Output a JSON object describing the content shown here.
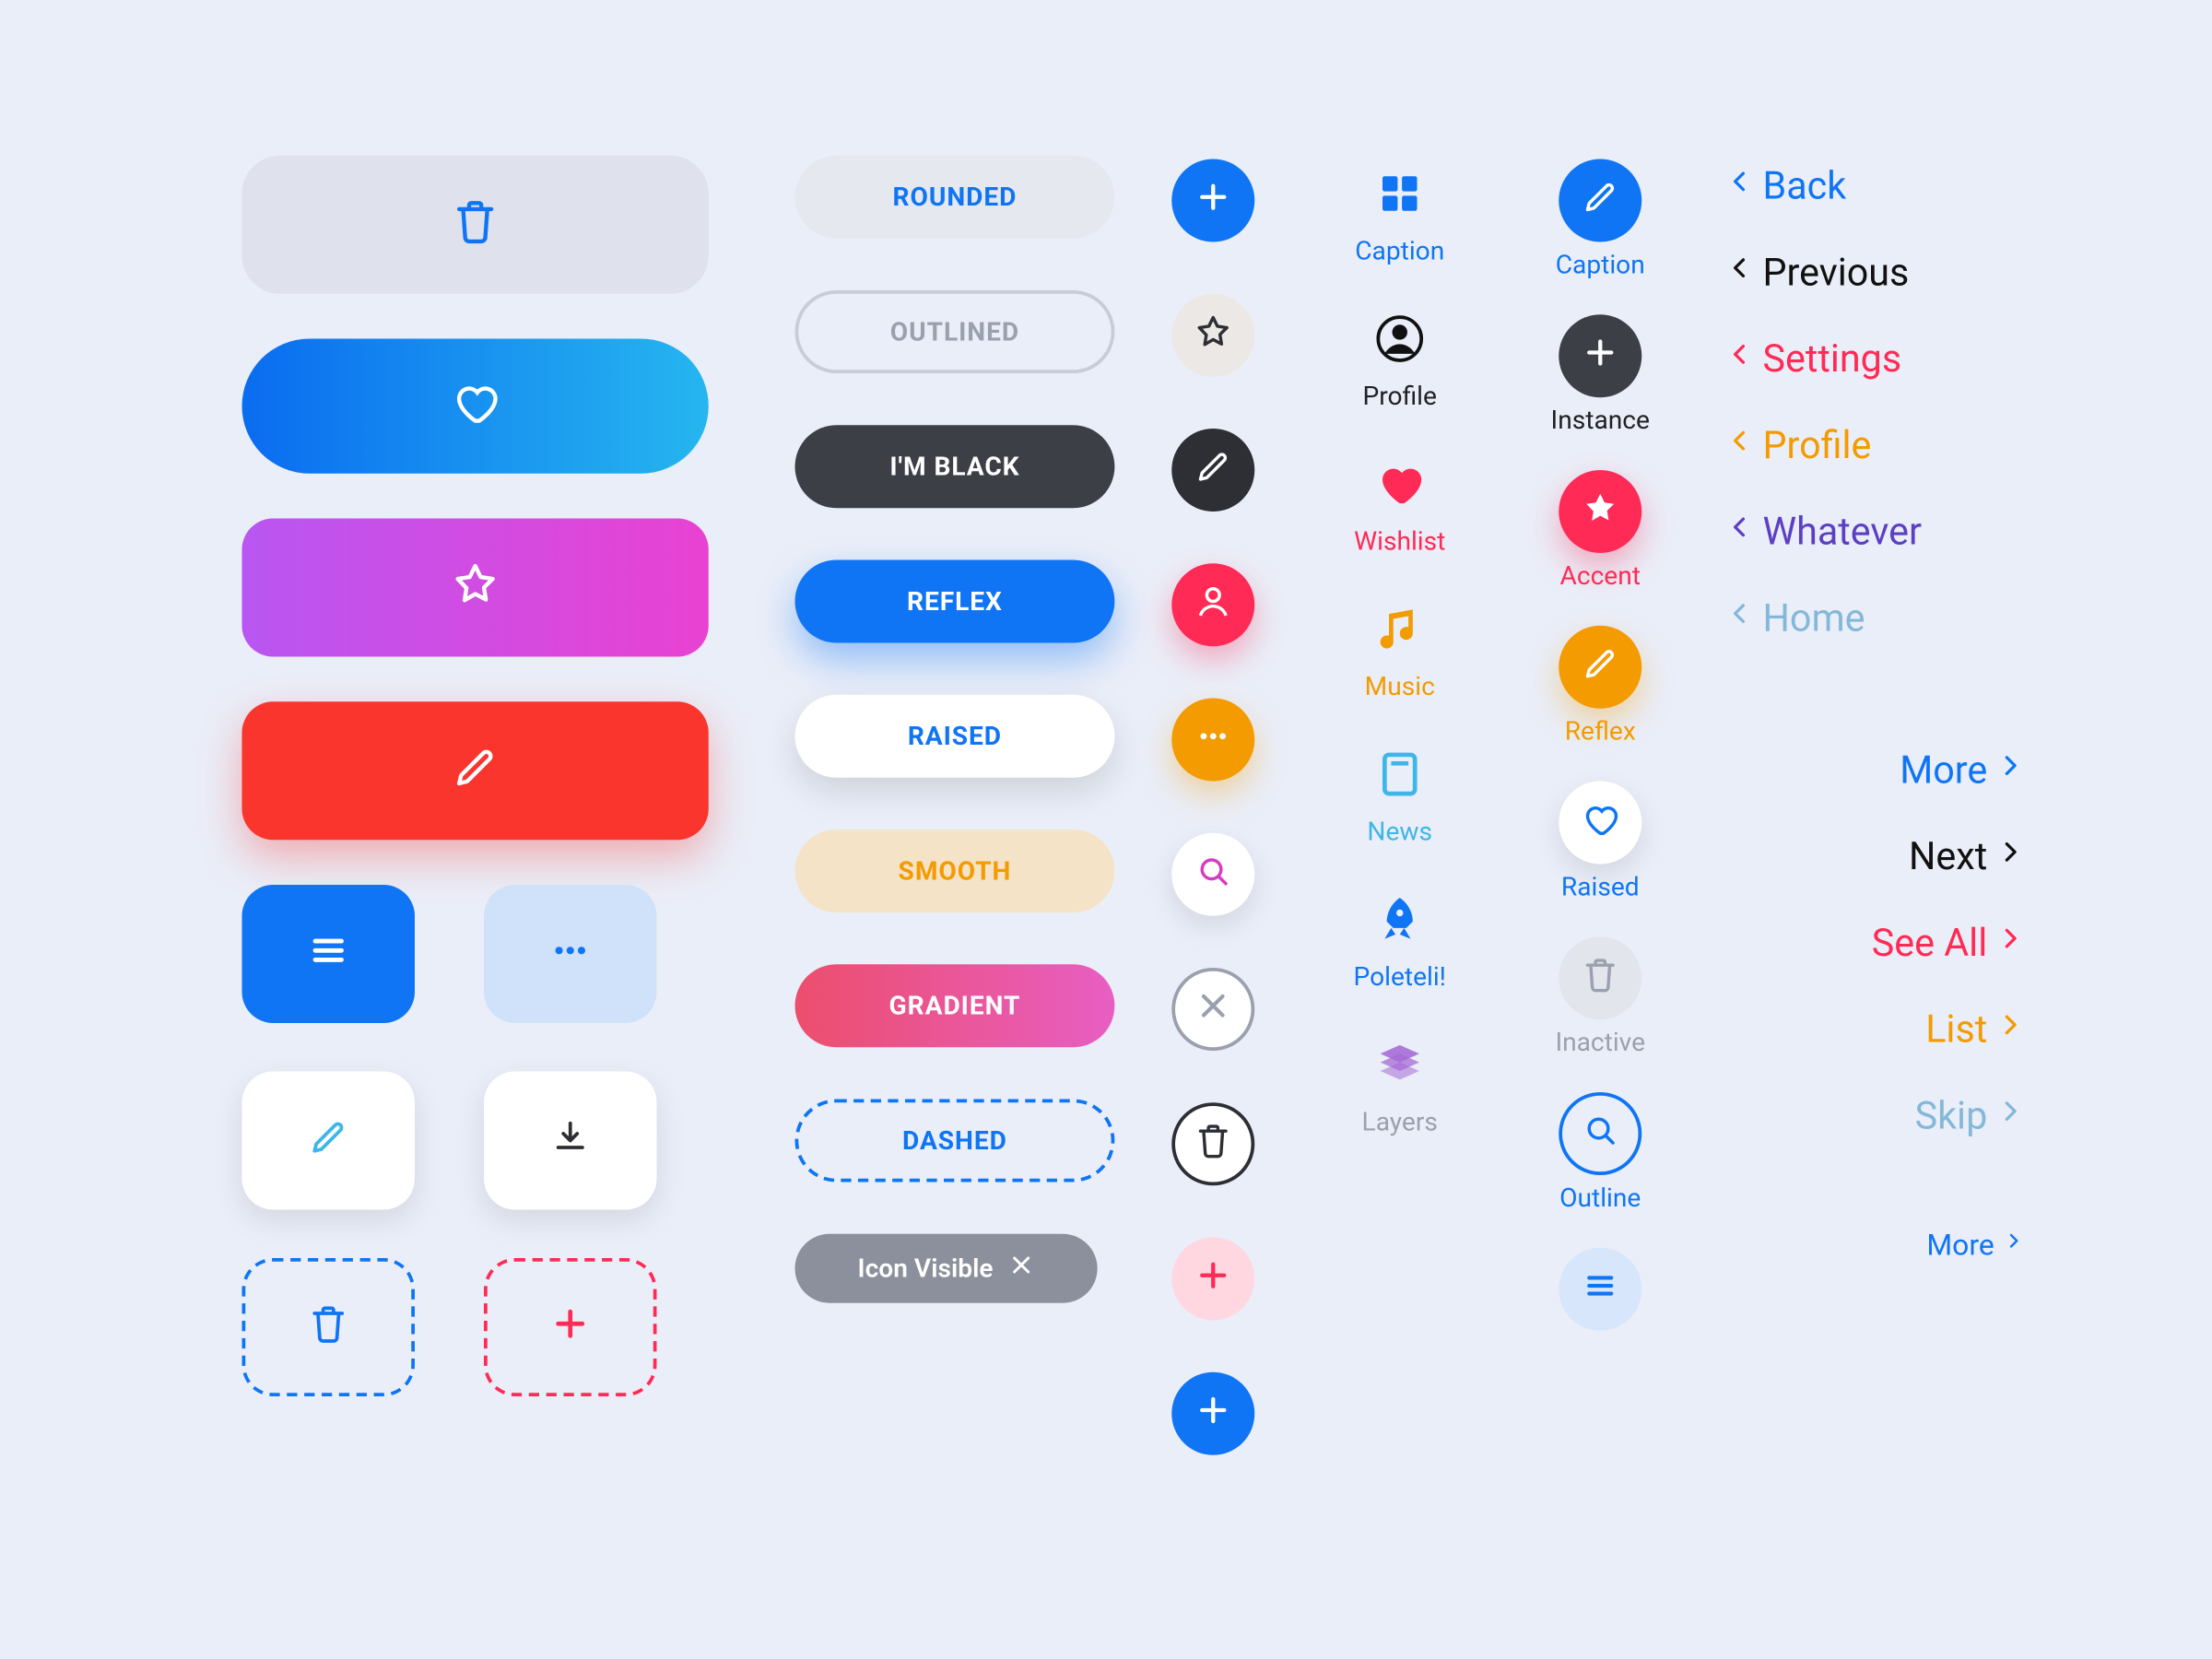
{
  "colors": {
    "blue": "#0f75f4",
    "red": "#f9352e",
    "pink": "#ff2a55",
    "orange": "#f39b00",
    "sky": "#3fb6e8",
    "purple": "#5c3fc4",
    "grey": "#9aa0ae"
  },
  "pills": {
    "rounded": "ROUNDED",
    "outlined": "OUTLINED",
    "black": "I'M BLACK",
    "reflex": "REFLEX",
    "raised": "RAISED",
    "smooth": "SMOOTH",
    "gradient": "GRADIENT",
    "dashed": "DASHED",
    "chip": "Icon Visible"
  },
  "captions": {
    "grid": "Caption",
    "profile": "Profile",
    "wishlist": "Wishlist",
    "music": "Music",
    "news": "News",
    "poleteli": "Poleteli!",
    "layers": "Layers"
  },
  "cirCap": {
    "edit": "Caption",
    "instance": "Instance",
    "accent": "Accent",
    "reflex": "Reflex",
    "raised": "Raised",
    "inactive": "Inactive",
    "outline": "Outline"
  },
  "nav": {
    "back": "Back",
    "previous": "Previous",
    "settings": "Settings",
    "profile": "Profile",
    "whatever": "Whatever",
    "home": "Home",
    "more": "More",
    "next": "Next",
    "seeall": "See All",
    "list": "List",
    "skip": "Skip",
    "more2": "More"
  }
}
